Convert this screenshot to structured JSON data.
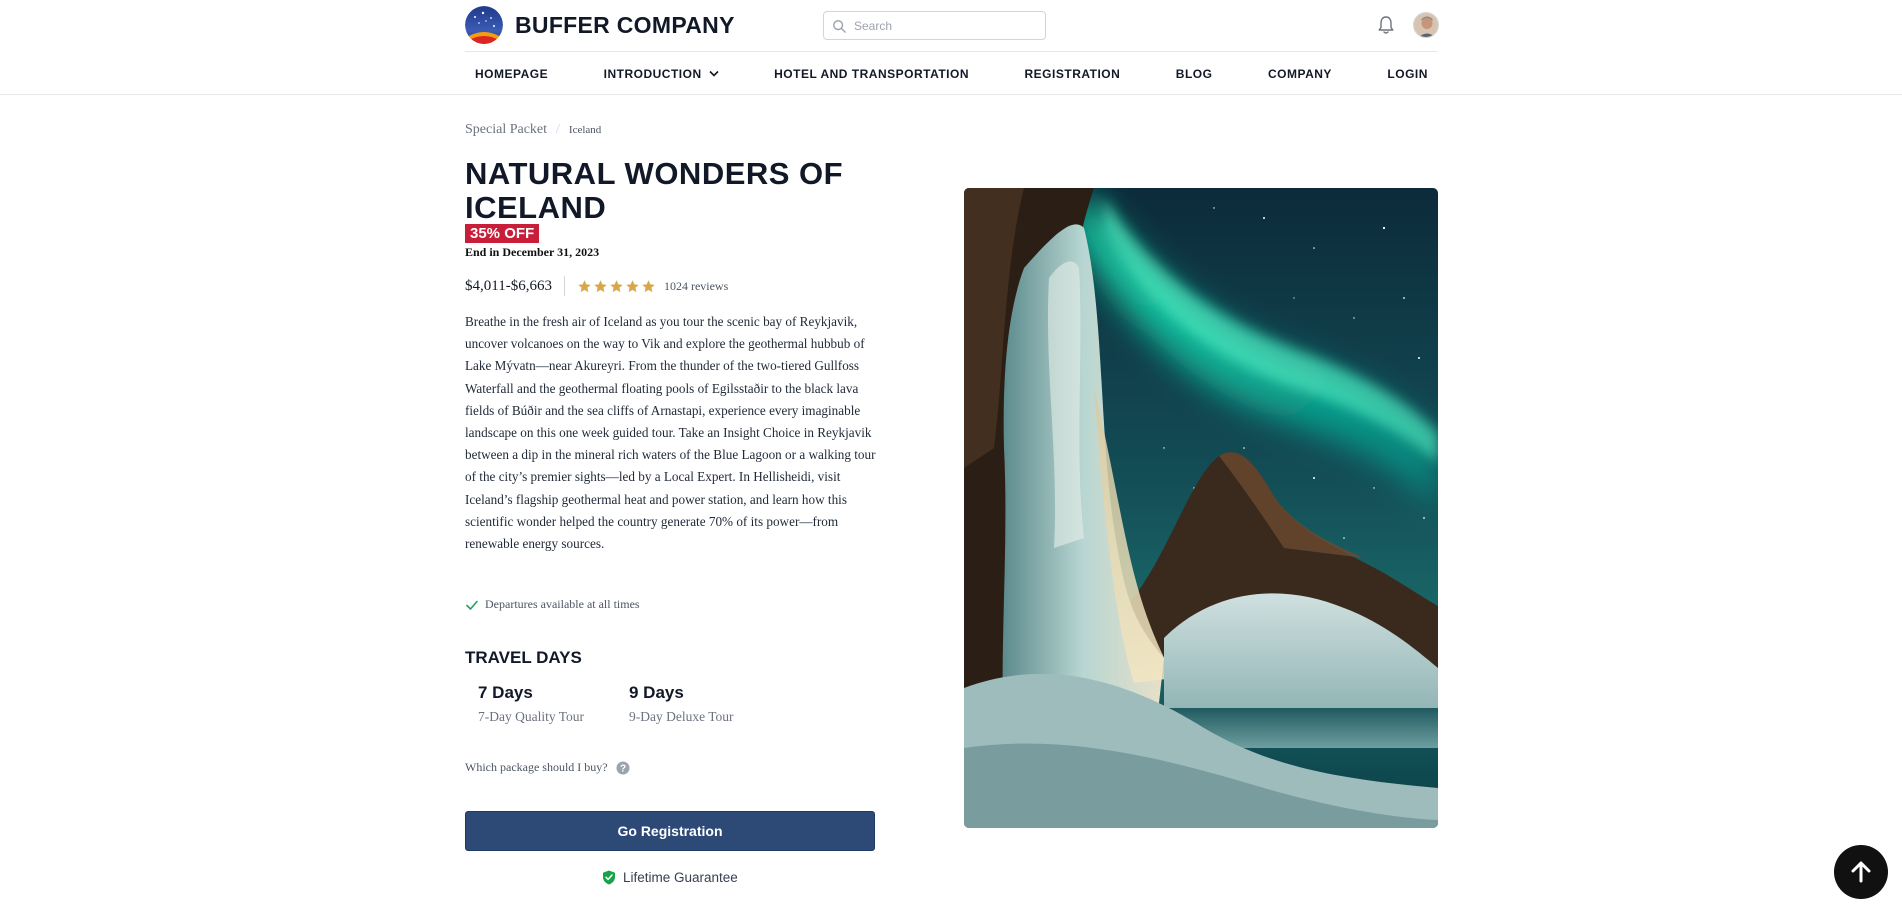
{
  "header": {
    "brand": "BUFFER COMPANY",
    "search_placeholder": "Search",
    "icons": {
      "logo": "starry-night-logo",
      "search": "search-icon",
      "notifications": "bell-icon",
      "avatar": "user-avatar"
    }
  },
  "nav": {
    "items": [
      {
        "label": "HOMEPAGE"
      },
      {
        "label": "INTRODUCTION",
        "has_dropdown": true
      },
      {
        "label": "HOTEL AND TRANSPORTATION"
      },
      {
        "label": "REGISTRATION"
      },
      {
        "label": "BLOG"
      },
      {
        "label": "COMPANY"
      },
      {
        "label": "LOGIN"
      }
    ]
  },
  "breadcrumb": [
    "Special Packet",
    "Iceland"
  ],
  "product": {
    "title": "NATURAL WONDERS OF ICELAND",
    "discount_badge": "35% OFF",
    "ends": "End in December 31, 2023",
    "price": "$4,011-$6,663",
    "rating": 5,
    "reviews": "1024 reviews",
    "description": "Breathe in the fresh air of Iceland as you tour the scenic bay of Reykjavik, uncover volcanoes on the way to Vik and explore the geothermal hubbub of Lake Mývatn—near Akureyri. From the thunder of the two-tiered Gullfoss Waterfall and the geothermal floating pools of Egilsstaðir to the black lava fields of Búðir and the sea cliffs of Arnastapi, experience every imaginable landscape on this one week guided tour. Take an Insight Choice in Reykjavik between a dip in the mineral rich waters of the Blue Lagoon or a walking tour of the city’s premier sights—led by a Local Expert. In Hellisheidi, visit Iceland’s flagship geothermal heat and power station, and learn how this scientific wonder helped the country generate 70% of its power—from renewable energy sources.",
    "departures": "Departures available at all times",
    "travel_days": {
      "heading": "TRAVEL DAYS",
      "options": [
        {
          "days": "7 Days",
          "name": "7-Day Quality Tour"
        },
        {
          "days": "9 Days",
          "name": "9-Day Deluxe Tour"
        }
      ]
    },
    "which_package": "Which package should I buy?",
    "cta": "Go Registration",
    "guarantee": "Lifetime Guarantee"
  },
  "colors": {
    "badge": "#c81e3a",
    "cta": "#2d4a77",
    "star": "#d4a84b",
    "check": "#22a35a",
    "shield": "#16a34a",
    "aurora": "#1de9b6"
  }
}
